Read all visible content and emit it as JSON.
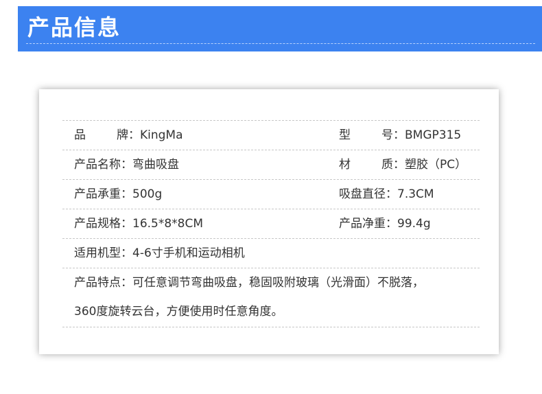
{
  "header": {
    "title": "产品信息"
  },
  "rows": [
    {
      "left": {
        "label_a": "品",
        "label_b": "牌：",
        "value": "KingMa"
      },
      "right": {
        "label_a": "型",
        "label_b": "号：",
        "value": "BMGP315"
      }
    },
    {
      "left": {
        "label": "产品名称：",
        "value": "弯曲吸盘"
      },
      "right": {
        "label_a": "材",
        "label_b": "质：",
        "value": "塑胶（PC）"
      }
    },
    {
      "left": {
        "label": "产品承重：",
        "value": "500g"
      },
      "right": {
        "label": "吸盘直径：",
        "value": "7.3CM"
      }
    },
    {
      "left": {
        "label": "产品规格：",
        "value": "16.5*8*8CM"
      },
      "right": {
        "label": "产品净重：",
        "value": "99.4g"
      }
    }
  ],
  "applicable": {
    "label": "适用机型：",
    "value": "4-6寸手机和运动相机"
  },
  "features": {
    "label": "产品特点：",
    "line1": "可任意调节弯曲吸盘，稳固吸附玻璃（光滑面）不脱落，",
    "line2": "360度旋转云台，方便使用时任意角度。"
  }
}
